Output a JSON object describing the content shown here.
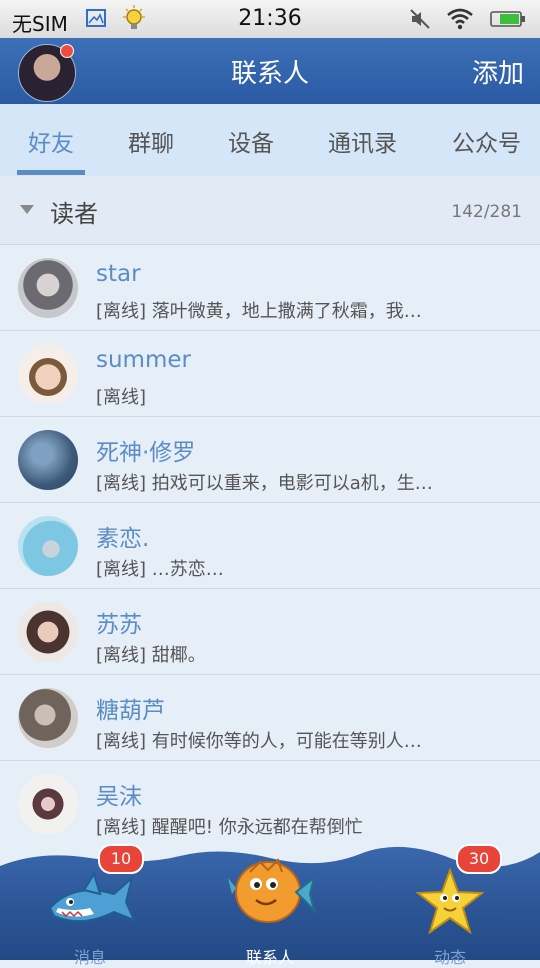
{
  "status_bar": {
    "carrier": "无SIM",
    "time": "21:36"
  },
  "header": {
    "title": "联系人",
    "add_label": "添加"
  },
  "tabs": [
    {
      "label": "好友",
      "active": true
    },
    {
      "label": "群聊",
      "active": false
    },
    {
      "label": "设备",
      "active": false
    },
    {
      "label": "通讯录",
      "active": false
    },
    {
      "label": "公众号",
      "active": false
    }
  ],
  "group": {
    "name": "读者",
    "count": "142/281"
  },
  "contacts": [
    {
      "name": "star",
      "status": "[离线] 落叶微黄，地上撒满了秋霜，我…"
    },
    {
      "name": "summer",
      "status": "[离线]"
    },
    {
      "name": "死神·修罗",
      "status": "[离线] 拍戏可以重来，电影可以a机，生…"
    },
    {
      "name": "素恋.",
      "status": "[离线] …苏恋…"
    },
    {
      "name": "苏苏",
      "status": "[离线] 甜椰。"
    },
    {
      "name": "糖葫芦",
      "status": "[离线] 有时候你等的人，可能在等别人…"
    },
    {
      "name": "吴沫",
      "status": "[离线] 醒醒吧! 你永远都在帮倒忙"
    }
  ],
  "bottom_nav": [
    {
      "label": "消息",
      "badge": "10",
      "icon": "shark-icon"
    },
    {
      "label": "联系人",
      "badge": "",
      "icon": "fish-icon",
      "active": true
    },
    {
      "label": "动态",
      "badge": "30",
      "icon": "starfish-icon"
    }
  ],
  "colors": {
    "header": "#2d5ca5",
    "accent": "#5b8dc4",
    "badge": "#e8443a",
    "tabs_bg": "#d4e6f7"
  }
}
